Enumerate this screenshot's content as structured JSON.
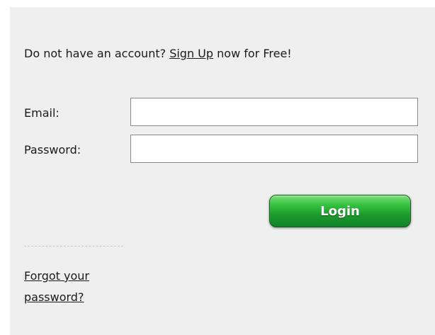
{
  "signup": {
    "prefix": "Do not have an account?",
    "link_label": "Sign Up",
    "suffix": "now for Free!"
  },
  "form": {
    "email_label": "Email:",
    "email_value": "",
    "password_label": "Password:",
    "password_value": ""
  },
  "login_button_label": "Login",
  "forgot_password_label": "Forgot your password?",
  "colors": {
    "panel_background": "#efefef",
    "login_button": "#1c9a2c",
    "text": "#1a1a1a"
  }
}
